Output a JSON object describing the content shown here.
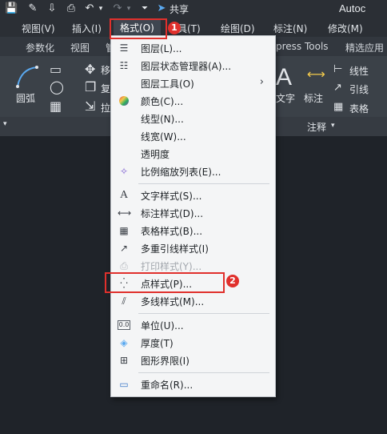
{
  "app": {
    "title": "Autoc",
    "share_label": "共享"
  },
  "menubar": {
    "items": [
      {
        "label": "视图(V)"
      },
      {
        "label": "插入(I)"
      },
      {
        "label": "格式(O)"
      },
      {
        "label": "具(T)"
      },
      {
        "label": "绘图(D)"
      },
      {
        "label": "标注(N)"
      },
      {
        "label": "修改(M)"
      }
    ]
  },
  "ribbon_tabs": {
    "items": [
      {
        "label": "参数化"
      },
      {
        "label": "视图"
      },
      {
        "label": "管"
      },
      {
        "label": "press Tools"
      },
      {
        "label": "精选应用"
      }
    ]
  },
  "ribbon": {
    "arc_label": "圆弧",
    "move_label": "移",
    "copy_label": "复",
    "stretch_label": "拉",
    "text_label": "文字",
    "dim_label": "标注",
    "linear_label": "线性",
    "leader_label": "引线",
    "table_label": "表格",
    "panel_annotation": "注释"
  },
  "dropdown": {
    "items": [
      {
        "label": "图层(L)...",
        "icon": "layer-icon"
      },
      {
        "label": "图层状态管理器(A)...",
        "icon": "layer-state-icon"
      },
      {
        "label": "图层工具(O)",
        "icon": ""
      },
      {
        "label": "颜色(C)...",
        "icon": "color-wheel-icon"
      },
      {
        "label": "线型(N)...",
        "icon": ""
      },
      {
        "label": "线宽(W)...",
        "icon": ""
      },
      {
        "label": "透明度",
        "icon": ""
      },
      {
        "label": "比例缩放列表(E)...",
        "icon": "scale-list-icon"
      },
      {
        "label": "文字样式(S)...",
        "icon": "text-style-icon"
      },
      {
        "label": "标注样式(D)...",
        "icon": "dim-style-icon"
      },
      {
        "label": "表格样式(B)...",
        "icon": "table-style-icon"
      },
      {
        "label": "多重引线样式(I)",
        "icon": "mleader-style-icon"
      },
      {
        "label": "打印样式(Y)...",
        "icon": "plot-style-icon"
      },
      {
        "label": "点样式(P)...",
        "icon": "point-style-icon"
      },
      {
        "label": "多线样式(M)...",
        "icon": "mline-style-icon"
      },
      {
        "label": "单位(U)...",
        "icon": "units-icon"
      },
      {
        "label": "厚度(T)",
        "icon": "thickness-icon"
      },
      {
        "label": "图形界限(I)",
        "icon": "limits-icon"
      },
      {
        "label": "重命名(R)...",
        "icon": "rename-icon"
      }
    ]
  },
  "annotations": {
    "badge_1": "1",
    "badge_2": "2",
    "color": "#e0302c"
  }
}
